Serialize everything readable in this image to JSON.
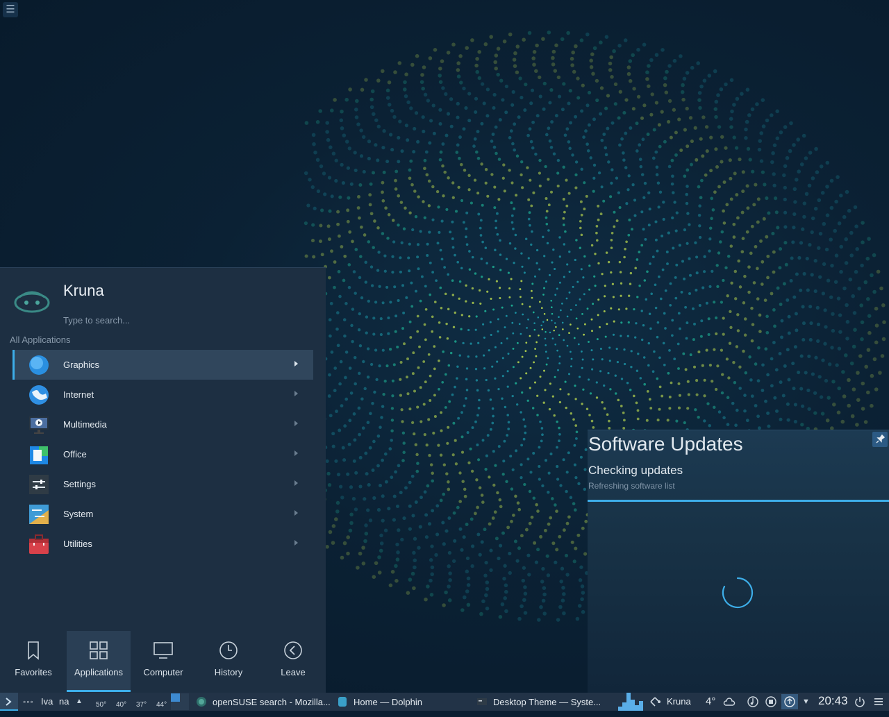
{
  "launcher": {
    "user_name": "Kruna",
    "search_placeholder": "Type to search...",
    "section_label": "All Applications",
    "items": [
      {
        "label": "Graphics",
        "icon": "graphics-icon",
        "active": true
      },
      {
        "label": "Internet",
        "icon": "internet-icon"
      },
      {
        "label": "Multimedia",
        "icon": "multimedia-icon"
      },
      {
        "label": "Office",
        "icon": "office-icon"
      },
      {
        "label": "Settings",
        "icon": "settings-icon"
      },
      {
        "label": "System",
        "icon": "system-icon"
      },
      {
        "label": "Utilities",
        "icon": "utilities-icon"
      }
    ],
    "tabs": [
      {
        "label": "Favorites",
        "icon": "bookmark-icon"
      },
      {
        "label": "Applications",
        "icon": "grid-icon",
        "active": true
      },
      {
        "label": "Computer",
        "icon": "monitor-icon"
      },
      {
        "label": "History",
        "icon": "clock-icon"
      },
      {
        "label": "Leave",
        "icon": "back-arrow-icon"
      }
    ]
  },
  "notification": {
    "title": "Software Updates",
    "subtitle": "Checking updates",
    "detail": "Refreshing software list"
  },
  "taskbar": {
    "activity_a": "Iva",
    "activity_b": "na",
    "temps": [
      "50°",
      "40°",
      "37°",
      "44°"
    ],
    "tasks": [
      {
        "label": "openSUSE search - Mozilla...",
        "icon": "firefox-icon"
      },
      {
        "label": "Home — Dolphin",
        "icon": "dolphin-icon"
      },
      {
        "label": "Desktop Theme — Syste...",
        "icon": "terminal-icon"
      }
    ],
    "kdeconnect_label": "Kruna",
    "weather_temp": "4°",
    "clock": "20:43"
  },
  "colors": {
    "accent": "#3daee9",
    "panel": "#1d2f42",
    "taskbar": "#223347"
  }
}
